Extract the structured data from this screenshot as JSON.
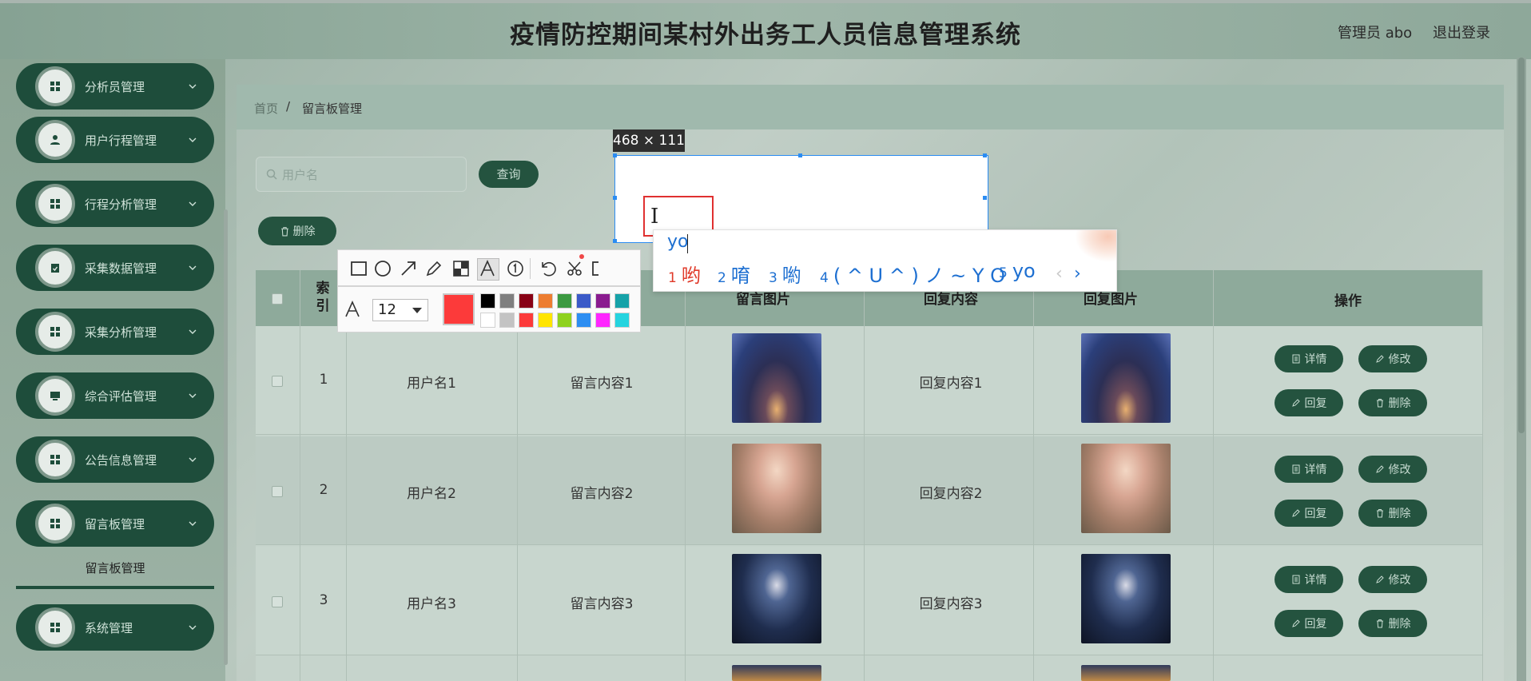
{
  "header": {
    "title": "疫情防控期间某村外出务工人员信息管理系统",
    "admin": "管理员 abo",
    "logout": "退出登录"
  },
  "sidebar": {
    "items": [
      {
        "label": "分析员管理",
        "icon": "grid-icon"
      },
      {
        "label": "用户行程管理",
        "icon": "user-icon"
      },
      {
        "label": "行程分析管理",
        "icon": "grid-icon"
      },
      {
        "label": "采集数据管理",
        "icon": "clipboard-icon"
      },
      {
        "label": "采集分析管理",
        "icon": "grid-icon"
      },
      {
        "label": "综合评估管理",
        "icon": "monitor-icon"
      },
      {
        "label": "公告信息管理",
        "icon": "grid-icon"
      },
      {
        "label": "留言板管理",
        "icon": "grid-icon"
      },
      {
        "label": "系统管理",
        "icon": "grid-icon"
      }
    ],
    "submenu": "留言板管理"
  },
  "breadcrumb": {
    "home": "首页",
    "sep": "/",
    "current": "留言板管理"
  },
  "search": {
    "placeholder": "用户名",
    "query_label": "查询",
    "delete_label": "删除"
  },
  "table": {
    "headers": {
      "index": "索引",
      "reply_content": "回复内容",
      "msg_image": "留言图片",
      "reply_image": "回复图片",
      "ops": "操作"
    },
    "rows": [
      {
        "index": "1",
        "user": "用户名1",
        "content": "留言内容1",
        "reply": "回复内容1"
      },
      {
        "index": "2",
        "user": "用户名2",
        "content": "留言内容2",
        "reply": "回复内容2"
      },
      {
        "index": "3",
        "user": "用户名3",
        "content": "留言内容3",
        "reply": "回复内容3"
      }
    ],
    "ops": {
      "detail": "详情",
      "edit": "修改",
      "reply": "回复",
      "delete": "删除"
    }
  },
  "capture": {
    "size": "468 × 111",
    "font_size": "12",
    "selected_color": "#fc3a3a",
    "swatches": [
      "#000000",
      "#7f7f7f",
      "#880015",
      "#ed7d31",
      "#3c9a41",
      "#3b5ac8",
      "#8a1b8f",
      "#16a2a8",
      "#ffffff",
      "#c3c3c3",
      "#fc3a3a",
      "#ffe500",
      "#8fd21e",
      "#2d8ef2",
      "#ff26ff",
      "#25d4df"
    ]
  },
  "ime": {
    "input": "yo",
    "candidates": [
      {
        "n": "1",
        "text": "哟"
      },
      {
        "n": "2",
        "text": "唷"
      },
      {
        "n": "3",
        "text": "喲"
      },
      {
        "n": "4",
        "text": "( ^ U ^ ) ノ ~ Y O"
      },
      {
        "n": "5",
        "text": "yo"
      }
    ],
    "prev": "‹",
    "next": "›"
  }
}
